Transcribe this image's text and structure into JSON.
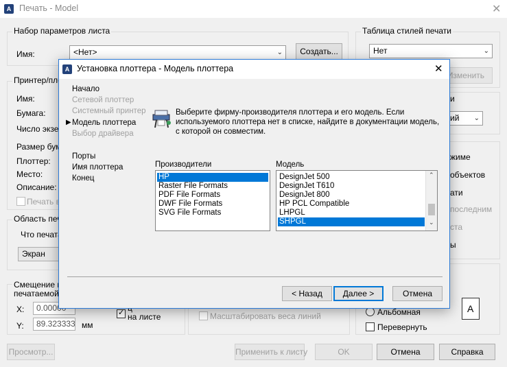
{
  "window": {
    "title": "Печать - Model",
    "close_glyph": "✕"
  },
  "page_setup": {
    "group_label": "Набор параметров листа",
    "name_label": "Имя:",
    "name_value": "<Нет>",
    "create_button": "Создать..."
  },
  "style_table": {
    "group_label": "Таблица стилей печати",
    "value": "Нет",
    "edit_button": "Изменить"
  },
  "printer": {
    "group_label": "Принтер/пло",
    "name_label": "Имя:",
    "paper_label": "Бумага:",
    "copies_label": "Число экзе",
    "size_label": "Размер бума",
    "plotter_label": "Плоттер:",
    "where_label": "Место:",
    "description_label": "Описание:",
    "print_to_file_label": "Печать в"
  },
  "shaded": {
    "label_fragment": "и",
    "combo_fragment": "ий"
  },
  "options_fragments": [
    "жиме",
    "объектов",
    "ати",
    "последним",
    "ста",
    "ы"
  ],
  "print_area": {
    "group_label": "Область печа",
    "what_label": "Что печата",
    "value": "Экран"
  },
  "offset": {
    "group_label_line1": "Смещение пе",
    "group_label_line2": "печатаемой з",
    "x_label": "X:",
    "x_value": "0.00000",
    "y_label": "Y:",
    "y_value": "89.323333",
    "units": "мм",
    "center_label_line1": "ц",
    "center_label_line2": "на листе"
  },
  "lineweights": {
    "scale_label": "Масштабировать веса линий"
  },
  "orientation": {
    "landscape_label": "Альбомная",
    "reverse_label": "Перевернуть",
    "page_icon_letter": "A"
  },
  "footer": {
    "preview_button": "Просмотр...",
    "apply_button": "Применить к листу",
    "ok_button": "OK",
    "cancel_button": "Отмена",
    "help_button": "Справка"
  },
  "wizard": {
    "title": "Установка плоттера - Модель плоттера",
    "steps": [
      {
        "label": "Начало",
        "state": "normal"
      },
      {
        "label": "Сетевой плоттер",
        "state": "disabled"
      },
      {
        "label": "Системный принтер",
        "state": "disabled"
      },
      {
        "label": "Модель плоттера",
        "state": "current"
      },
      {
        "label": "Выбор драйвера",
        "state": "disabled"
      },
      {
        "label": "Порты",
        "state": "normal"
      },
      {
        "label": "Имя плоттера",
        "state": "normal"
      },
      {
        "label": "Конец",
        "state": "normal"
      }
    ],
    "description": "Выберите фирму-производителя плоттера и его модель. Если используемого плоттера нет в списке, найдите в документации модель, с которой он совместим.",
    "manufacturers_label": "Производители",
    "manufacturers": [
      "HP",
      "Raster File Formats",
      "PDF File Formats",
      "DWF File Formats",
      "SVG File Formats"
    ],
    "manufacturer_selected": "HP",
    "model_label": "Модель",
    "models": [
      "DesignJet 500",
      "DesignJet T610",
      "DesignJet 800",
      "HP PCL Compatible",
      "LHPGL",
      "SHPGL"
    ],
    "model_selected": "SHPGL",
    "back_button": "< Назад",
    "next_button": "Далее >",
    "cancel_button": "Отмена",
    "close_glyph": "✕"
  },
  "colors": {
    "selection": "#0078d7",
    "focus_border": "#2b79d6"
  }
}
